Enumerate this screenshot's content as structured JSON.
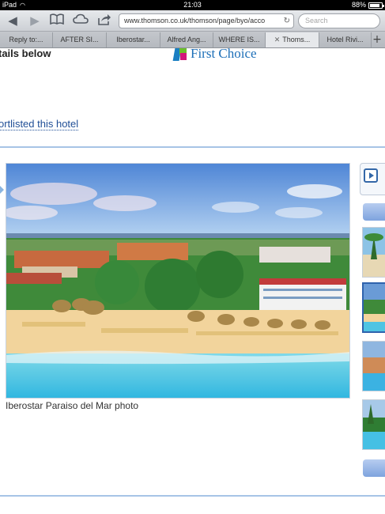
{
  "status_bar": {
    "device": "iPad",
    "time": "21:03",
    "battery": "88%",
    "battery_level": 0.88
  },
  "toolbar": {
    "url": "www.thomson.co.uk/thomson/page/byo/acco",
    "search_placeholder": "Search",
    "icons": [
      "back-icon",
      "forward-icon",
      "bookmarks-icon",
      "icloud-icon",
      "share-icon"
    ]
  },
  "tabs": [
    {
      "label": "Reply to:..."
    },
    {
      "label": "AFTER SI..."
    },
    {
      "label": "Iberostar..."
    },
    {
      "label": "Alfred Ang..."
    },
    {
      "label": "WHERE IS..."
    },
    {
      "label": "Thoms...",
      "active": true
    },
    {
      "label": "Hotel Rivi..."
    }
  ],
  "page": {
    "heading_fragment": "tails below",
    "logo_text": "First Choice",
    "shortlist_link": "ortlisted this hotel",
    "photo_caption": "Iberostar Paraiso del Mar photo"
  },
  "colors": {
    "link": "#1f4e96",
    "divider": "#a7c4e6",
    "brand_blue": "#1d6fb8"
  }
}
